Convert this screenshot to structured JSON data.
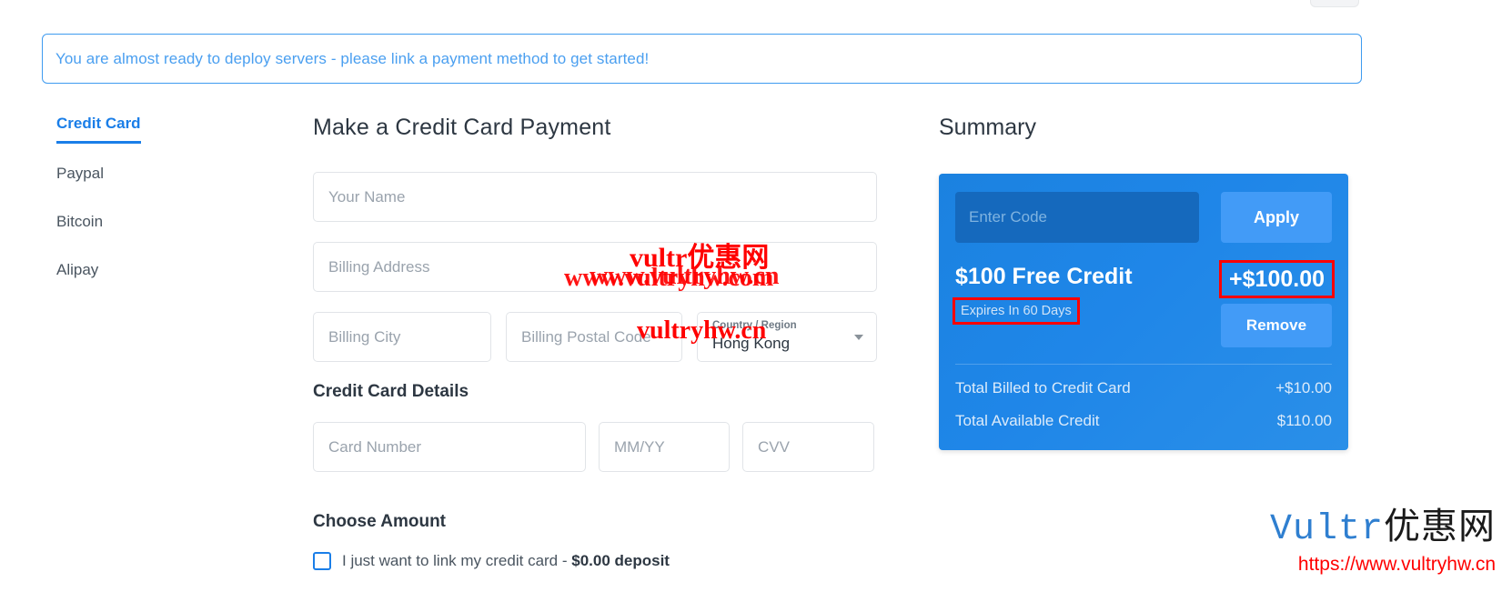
{
  "alert": {
    "message": "You are almost ready to deploy servers - please link a payment method to get started!"
  },
  "sidebar": {
    "items": [
      {
        "label": "Credit Card",
        "active": true
      },
      {
        "label": "Paypal",
        "active": false
      },
      {
        "label": "Bitcoin",
        "active": false
      },
      {
        "label": "Alipay",
        "active": false
      }
    ]
  },
  "main": {
    "title": "Make a Credit Card Payment",
    "fields": {
      "name_placeholder": "Your Name",
      "address_placeholder": "Billing Address",
      "city_placeholder": "Billing City",
      "postal_placeholder": "Billing Postal Code",
      "country_label": "Country / Region",
      "country_value": "Hong Kong"
    },
    "card_section_title": "Credit Card Details",
    "card_fields": {
      "number_placeholder": "Card Number",
      "expiry_placeholder": "MM/YY",
      "cvv_placeholder": "CVV"
    },
    "amount_section_title": "Choose Amount",
    "link_only_label": "I just want to link my credit card - ",
    "link_only_amount": "$0.00 deposit"
  },
  "summary": {
    "title": "Summary",
    "code_placeholder": "Enter Code",
    "apply_label": "Apply",
    "credit": {
      "name": "$100 Free Credit",
      "expires": "Expires In 60 Days",
      "amount": "+$100.00",
      "remove_label": "Remove"
    },
    "totals": [
      {
        "label": "Total Billed to Credit Card",
        "value": "+$10.00"
      },
      {
        "label": "Total Available Credit",
        "value": "$110.00"
      }
    ]
  },
  "watermarks": {
    "w1": "vultr优惠网",
    "w2": "www.vultryhw.com",
    "w3": "www.vultryhw.cn",
    "w4": "vultryhw.cn",
    "brand_en": "Vultr",
    "brand_cn": "优惠网",
    "brand_url": "https://www.vultryhw.cn"
  },
  "colors": {
    "accent": "#1a7ee8",
    "summary_bg": "#1f86e8",
    "alert_border": "#3f9bf0",
    "annotation": "#ff0000"
  }
}
